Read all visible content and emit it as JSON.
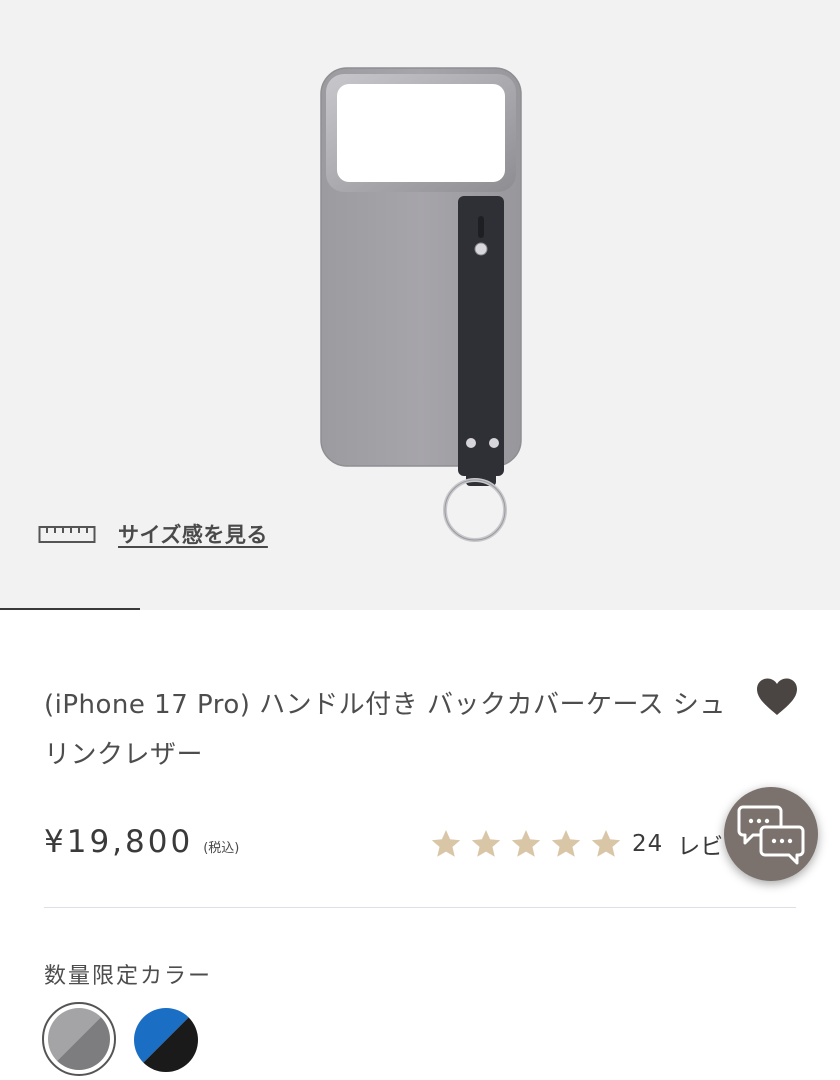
{
  "product": {
    "title": "(iPhone 17 Pro) ハンドル付き バックカバーケース シュリンクレザー",
    "price": "¥19,800",
    "tax_note": "(税込)",
    "size_link_label": "サイズ感を見る"
  },
  "rating": {
    "stars": 5,
    "count": "24",
    "label": "レビ"
  },
  "colors": {
    "section_label": "数量限定カラー",
    "swatches": [
      {
        "name": "gray",
        "selected": true,
        "colors": [
          "#a4a4a6",
          "#7d7d80"
        ]
      },
      {
        "name": "blue-black",
        "selected": false,
        "colors": [
          "#1a6fc4",
          "#1a1a1a"
        ]
      }
    ]
  },
  "theme": {
    "hero_bg": "#f2f2f2",
    "case_color": "#a2a1a6",
    "strap_color": "#2e3035",
    "star_color": "#d9c6a7",
    "chat_button_color": "#7b716d",
    "heart_color": "#4a4542"
  },
  "icons": [
    "ruler-icon",
    "heart-icon",
    "star-icon",
    "chat-bubbles-icon"
  ]
}
